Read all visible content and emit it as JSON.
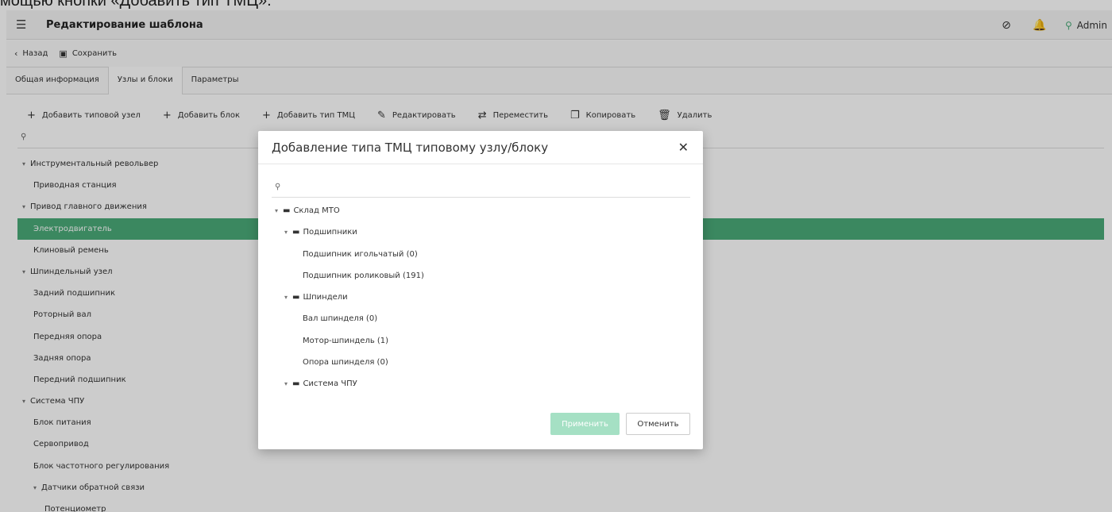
{
  "caption": "мощью кнопки «Добавить тип ТМЦ».",
  "topbar": {
    "title": "Редактирование шаблона",
    "user_name": "Admin"
  },
  "actionbar": {
    "back_label": "Назад",
    "save_label": "Сохранить"
  },
  "tabs": [
    {
      "label": "Общая информация"
    },
    {
      "label": "Узлы и блоки"
    },
    {
      "label": "Параметры"
    }
  ],
  "toolbar": {
    "add_typical_node": "Добавить типовой узел",
    "add_block": "Добавить блок",
    "add_tmc_type": "Добавить тип ТМЦ",
    "edit": "Редактировать",
    "move": "Переместить",
    "copy": "Копировать",
    "delete": "Удалить"
  },
  "tree": [
    {
      "label": "Инструментальный револьвер"
    },
    {
      "label": "Приводная станция"
    },
    {
      "label": "Привод главного движения"
    },
    {
      "label": "Электродвигатель"
    },
    {
      "label": "Клиновый ремень"
    },
    {
      "label": "Шпиндельный узел"
    },
    {
      "label": "Задний подшипник"
    },
    {
      "label": "Роторный вал"
    },
    {
      "label": "Передняя опора"
    },
    {
      "label": "Задняя опора"
    },
    {
      "label": "Передний подшипник"
    },
    {
      "label": "Система ЧПУ"
    },
    {
      "label": "Блок питания"
    },
    {
      "label": "Сервопривод"
    },
    {
      "label": "Блок частотного регулирования"
    },
    {
      "label": "Датчики обратной связи"
    },
    {
      "label": "Потенциометр"
    }
  ],
  "modal": {
    "title": "Добавление типа ТМЦ типовому узлу/блоку",
    "tree": [
      {
        "label": "Склад МТО"
      },
      {
        "label": "Подшипники"
      },
      {
        "label": "Подшипник игольчатый (0)"
      },
      {
        "label": "Подшипник роликовый (191)"
      },
      {
        "label": "Шпиндели"
      },
      {
        "label": "Вал шпинделя (0)"
      },
      {
        "label": "Мотор-шпиндель (1)"
      },
      {
        "label": "Опора шпинделя (0)"
      },
      {
        "label": "Система ЧПУ"
      }
    ],
    "apply_label": "Применить",
    "cancel_label": "Отменить"
  }
}
